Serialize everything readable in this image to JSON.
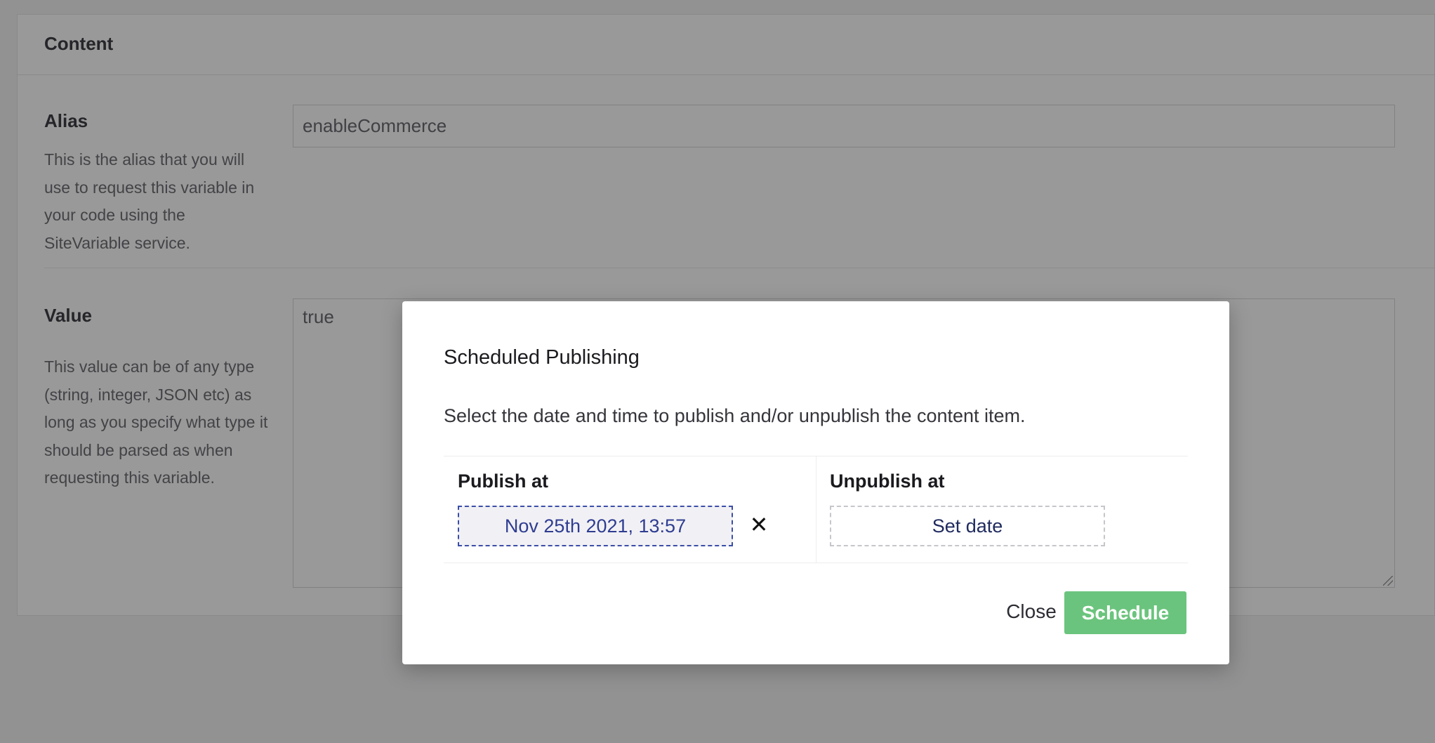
{
  "content_panel": {
    "title": "Content",
    "alias": {
      "label": "Alias",
      "description": "This is the alias that you will use to request this variable in your code using the SiteVariable service.",
      "value": "enableCommerce"
    },
    "value": {
      "label": "Value",
      "description": "This value can be of any type (string, integer, JSON etc) as long as you specify what type it should be parsed as when requesting this variable.",
      "value": "true"
    }
  },
  "modal": {
    "title": "Scheduled Publishing",
    "text": "Select the date and time to publish and/or unpublish the content item.",
    "publish": {
      "label": "Publish at",
      "date": "Nov 25th 2021, 13:57",
      "clear_icon": "close-icon"
    },
    "unpublish": {
      "label": "Unpublish at",
      "button": "Set date"
    },
    "close_label": "Close",
    "schedule_label": "Schedule"
  },
  "colors": {
    "overlay": "rgba(0,0,0,0.4)",
    "schedule_button": "#6bc47d",
    "date_text": "#2f3d91"
  }
}
